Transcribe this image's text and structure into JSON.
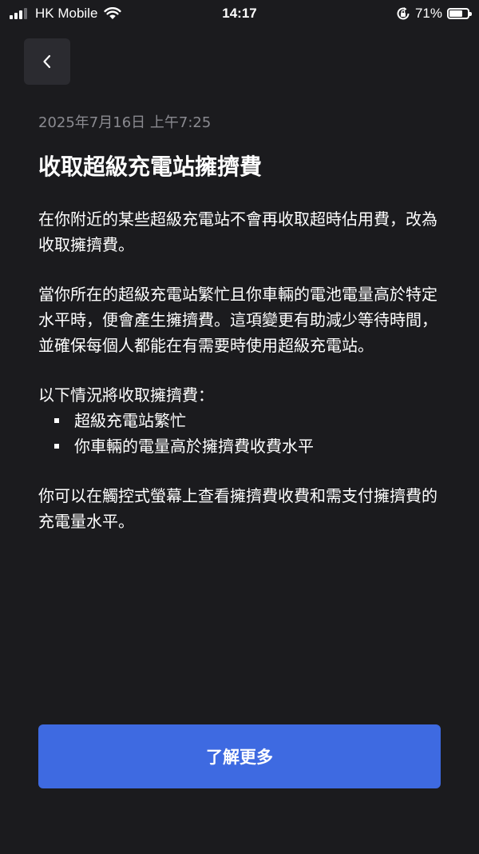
{
  "status_bar": {
    "carrier": "HK Mobile",
    "time": "14:17",
    "battery_percent_label": "71%",
    "battery_level": 0.71,
    "icons": [
      "signal-icon",
      "wifi-icon",
      "rotation-lock-icon",
      "battery-icon"
    ]
  },
  "nav": {
    "back_icon": "chevron-left-icon"
  },
  "article": {
    "date": "2025年7月16日 上午7:25",
    "title": "收取超級充電站擁擠費",
    "paragraph_1": "在你附近的某些超級充電站不會再收取超時佔用費，改為收取擁擠費。",
    "paragraph_2": "當你所在的超級充電站繁忙且你車輛的電池電量高於特定水平時，便會產生擁擠費。這項變更有助減少等待時間，並確保每個人都能在有需要時使用超級充電站。",
    "list_intro": "以下情況將收取擁擠費：",
    "conditions": [
      "超級充電站繁忙",
      "你車輛的電量高於擁擠費收費水平"
    ],
    "paragraph_4": "你可以在觸控式螢幕上查看擁擠費收費和需支付擁擠費的充電量水平。"
  },
  "actions": {
    "learn_more_label": "了解更多"
  },
  "colors": {
    "background": "#1b1b1e",
    "back_button_bg": "#2b2b30",
    "accent": "#3e6ae1",
    "date_text": "#8a8a90"
  }
}
